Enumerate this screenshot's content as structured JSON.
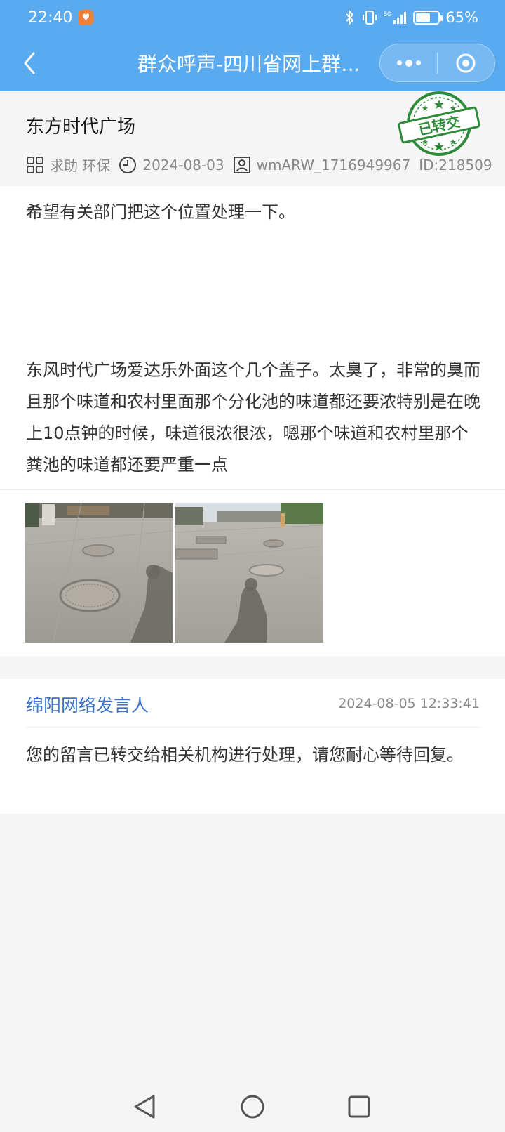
{
  "status_bar": {
    "time": "22:40",
    "network": "5G",
    "battery_percent": "65%",
    "battery_level": 0.65
  },
  "nav": {
    "title": "群众呼声-四川省网上群众工作平台",
    "more_icon": "more-dots-icon",
    "close_icon": "target-close-icon"
  },
  "post": {
    "title": "东方时代广场",
    "category": "求助 环保",
    "date": "2024-08-03",
    "author": "wmARW_1716949967",
    "id": "ID:218509",
    "stamp_text": "已转交"
  },
  "content": {
    "paragraph1": "希望有关部门把这个位置处理一下。",
    "paragraph2": "东风时代广场爱达乐外面这个几个盖子。太臭了，非常的臭而且那个味道和农村里面那个分化池的味道都还要浓特别是在晚上10点钟的时候，味道很浓很浓，嗯那个味道和农村里那个粪池的味道都还要严重一点"
  },
  "images": [
    {
      "name": "manhole-photo-1"
    },
    {
      "name": "manhole-photo-2"
    }
  ],
  "reply": {
    "name": "绵阳网络发言人",
    "time": "2024-08-05 12:33:41",
    "text": "您的留言已转交给相关机构进行处理，请您耐心等待回复。"
  },
  "colors": {
    "header_blue": "#5aaaf0",
    "reply_name_blue": "#3a73c8",
    "stamp_green": "#2e8b3a"
  }
}
